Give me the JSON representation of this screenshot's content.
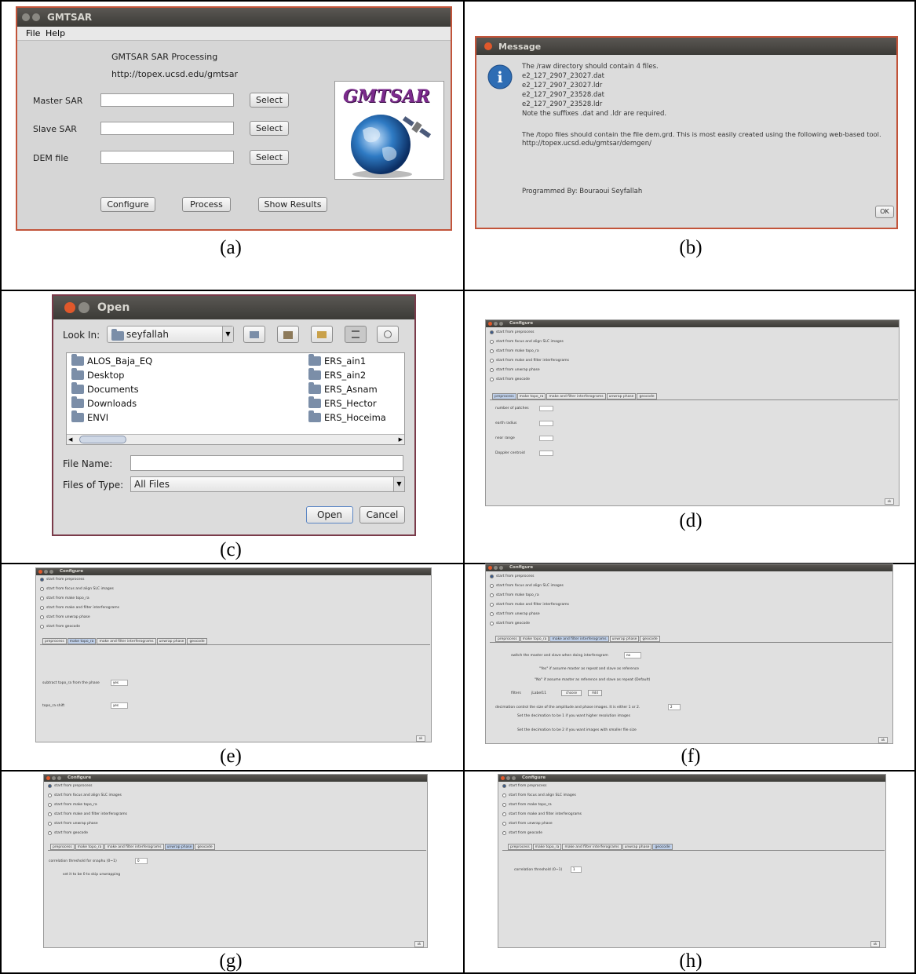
{
  "captions": [
    "(a)",
    "(b)",
    "(c)",
    "(d)",
    "(e)",
    "(f)",
    "(g)",
    "(h)"
  ],
  "panel_a": {
    "title": "GMTSAR",
    "menu": [
      "File",
      "Help"
    ],
    "heading": "GMTSAR SAR Processing",
    "url": "http://topex.ucsd.edu/gmtsar",
    "rows": [
      {
        "label": "Master SAR",
        "button": "Select"
      },
      {
        "label": "Slave SAR",
        "button": "Select"
      },
      {
        "label": "DEM file",
        "button": "Select"
      }
    ],
    "logo_text": "GMTSAR",
    "buttons": [
      "Configure",
      "Process",
      "Show Results"
    ]
  },
  "panel_b": {
    "title": "Message",
    "lines": [
      "The /raw directory should contain 4 files.",
      "e2_127_2907_23027.dat",
      "e2_127_2907_23027.ldr",
      "e2_127_2907_23528.dat",
      "e2_127_2907_23528.ldr",
      "Note the suffixes .dat and .ldr are required.",
      "The /topo files should contain the file dem.grd.  This is most easily created using the following web-based tool.",
      "http://topex.ucsd.edu/gmtsar/demgen/",
      "Programmed By: Bouraoui Seyfallah"
    ],
    "ok": "OK"
  },
  "panel_c": {
    "title": "Open",
    "look_in_label": "Look In:",
    "look_in_value": "seyfallah",
    "folders_left": [
      "ALOS_Baja_EQ",
      "Desktop",
      "Documents",
      "Downloads",
      "ENVI"
    ],
    "folders_right": [
      "ERS_ain1",
      "ERS_ain2",
      "ERS_Asnam",
      "ERS_Hector",
      "ERS_Hoceima"
    ],
    "file_name_label": "File Name:",
    "file_name_value": "",
    "files_of_type_label": "Files of Type:",
    "files_of_type_value": "All Files",
    "open": "Open",
    "cancel": "Cancel"
  },
  "configure": {
    "title": "Configure",
    "radios": [
      "start from preprocess",
      "start from focus and align SLC images",
      "start from make topo_ra",
      "start from make and filter interferograms",
      "start from unwrap phase",
      "start from geocode"
    ],
    "tabs": [
      "preprocess",
      "make topo_ra",
      "make and filter interferograms",
      "unwrap phase",
      "geocode"
    ],
    "ok": "ok"
  },
  "panel_d": {
    "fields": [
      "number of patches",
      "earth radius",
      "near range",
      "Doppler centroid"
    ]
  },
  "panel_e": {
    "rows": [
      {
        "label": "subtract topo_ra from the phase",
        "value": "yes"
      },
      {
        "label": "topo_ra shift",
        "value": "yes"
      }
    ]
  },
  "panel_f": {
    "switch_label": "switch the master and slave when doing interferogram",
    "switch_value": "no",
    "note1": "\"Yes\" if assume master as repeat and slave as reference",
    "note2": "\"No\" if assume master as reference and slave as repeat (Default)",
    "filters_label": "filters",
    "filters_value": "jLabel11",
    "choose": "choose",
    "add": "Add",
    "decimation_label": "decimation control the size of the amplitude and phase images. It is either 1 or 2.",
    "decimation_value": "2",
    "dec_note1": "Set the decimation to be 1 if you want higher resolution images",
    "dec_note2": "Set the decimation to be 2 if you want images with smaller file size"
  },
  "panel_g": {
    "label": "correlation threshold for snaphu (0~1)",
    "value": "0",
    "note": "set it to be 0 to skip unwrapping"
  },
  "panel_h": {
    "label": "correlation threshold (0~1)",
    "value": "1"
  }
}
